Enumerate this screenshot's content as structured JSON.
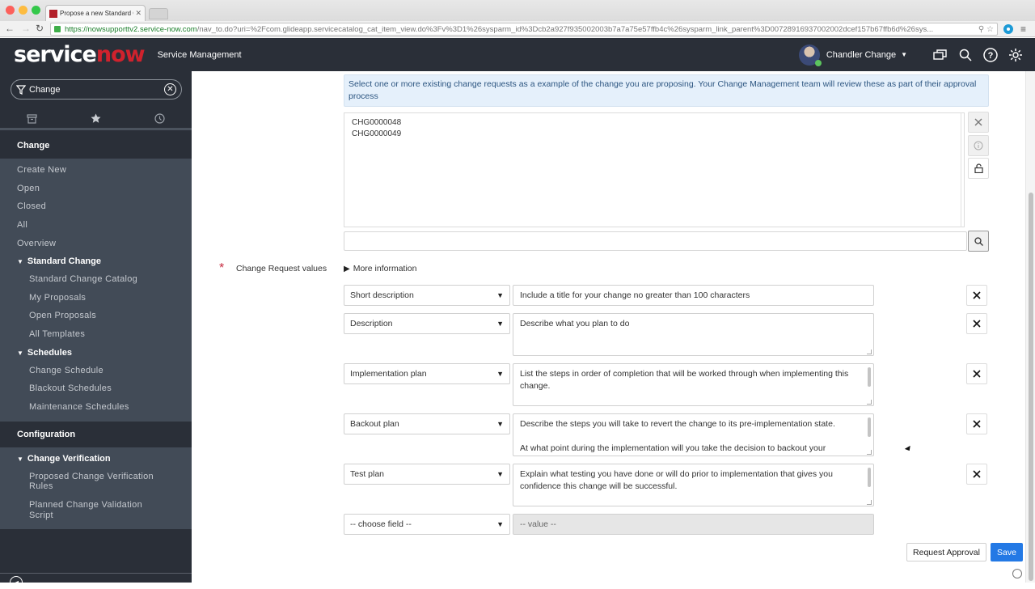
{
  "browser": {
    "tab_title": "Propose a new Standard C",
    "url_host": "https://nowsupporttv2.service-now.com",
    "url_path": "/nav_to.do?uri=%2Fcom.glideapp.servicecatalog_cat_item_view.do%3Fv%3D1%26sysparm_id%3Dcb2a927f935002003b7a7a75e57ffb4c%26sysparm_link_parent%3D00728916937002002dcef157b67ffb6d%26sys..."
  },
  "header": {
    "logo_service": "service",
    "logo_now": "now",
    "app_name": "Service Management",
    "user_name": "Chandler Change"
  },
  "sidebar": {
    "filter_value": "Change",
    "sections": [
      {
        "title": "Change",
        "items": [
          {
            "label": "Create New"
          },
          {
            "label": "Open"
          },
          {
            "label": "Closed"
          },
          {
            "label": "All"
          },
          {
            "label": "Overview"
          }
        ],
        "modules": [
          {
            "title": "Standard Change",
            "items": [
              {
                "label": "Standard Change Catalog"
              },
              {
                "label": "My Proposals"
              },
              {
                "label": "Open Proposals"
              },
              {
                "label": "All Templates"
              }
            ]
          },
          {
            "title": "Schedules",
            "items": [
              {
                "label": "Change Schedule"
              },
              {
                "label": "Blackout Schedules"
              },
              {
                "label": "Maintenance Schedules"
              }
            ]
          }
        ]
      },
      {
        "title": "Configuration",
        "modules": [
          {
            "title": "Change Verification",
            "items": [
              {
                "label": "Proposed Change Verification Rules"
              },
              {
                "label": "Planned Change Validation Script"
              }
            ]
          }
        ]
      }
    ]
  },
  "form": {
    "info_text": "Select one or more existing change requests as a example of the change you are proposing. Your Change Management team will review these as part of their approval process",
    "selected_changes": [
      "CHG0000048",
      "CHG0000049"
    ],
    "lookup_value": "",
    "change_request_label": "Change Request values",
    "more_info_label": "More information",
    "rows": [
      {
        "field": "Short description",
        "value": "Include a title for your change no greater than 100 characters"
      },
      {
        "field": "Description",
        "value": "Describe what you plan to do"
      },
      {
        "field": "Implementation plan",
        "value": "List the steps in order of completion that will be worked through when implementing this change."
      },
      {
        "field": "Backout plan",
        "value": "Describe the steps you will take to revert the change to its pre-implementation state.\n\nAt what point during the implementation will you take the decision to backout your change?"
      },
      {
        "field": "Test plan",
        "value": "Explain what testing you have done or will do prior to implementation that gives you confidence this change will be successful."
      }
    ],
    "new_row": {
      "field": "-- choose field --",
      "value": "-- value --"
    },
    "request_approval_label": "Request Approval",
    "save_label": "Save"
  }
}
